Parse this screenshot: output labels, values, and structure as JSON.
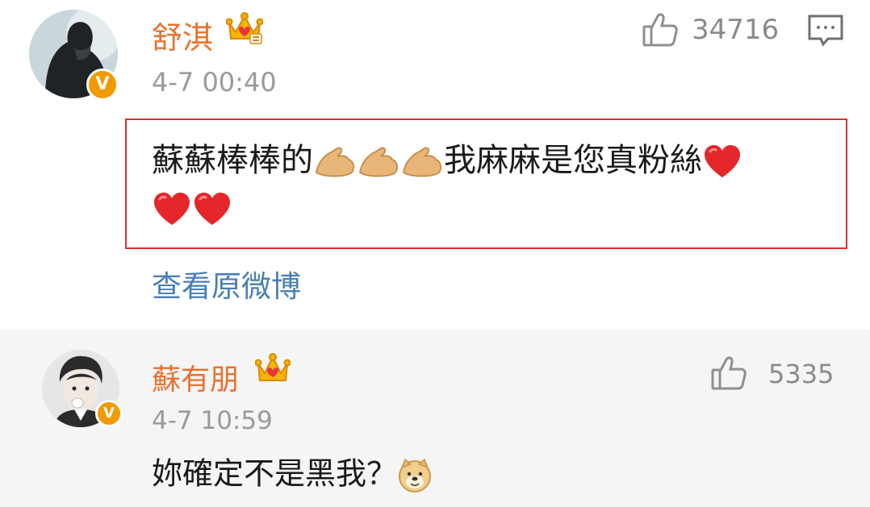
{
  "comments": [
    {
      "username": "舒淇",
      "time": "4-7 00:40",
      "likes": "34716",
      "text_line1": "蘇蘇棒棒的",
      "text_line1b": "我麻麻是您真粉絲",
      "emoji_muscle": "💪",
      "emoji_heart": "❤️",
      "view_original": "查看原微博",
      "badge_letter": "V",
      "icons": [
        "avatar",
        "verified-badge",
        "vip-crown-icon",
        "like-icon",
        "reply-icon"
      ]
    },
    {
      "username": "蘇有朋",
      "time": "4-7 10:59",
      "likes": "5335",
      "text": "妳確定不是黑我？",
      "badge_letter": "V",
      "icons": [
        "avatar",
        "verified-badge",
        "vip-crown-icon",
        "like-icon",
        "doge-emoji"
      ]
    }
  ],
  "colors": {
    "username": "#e8722e",
    "link": "#4a7fb5",
    "highlight_border": "#d9312f",
    "verified_badge": "#f29a00",
    "second_bg": "#f5f5f5"
  }
}
